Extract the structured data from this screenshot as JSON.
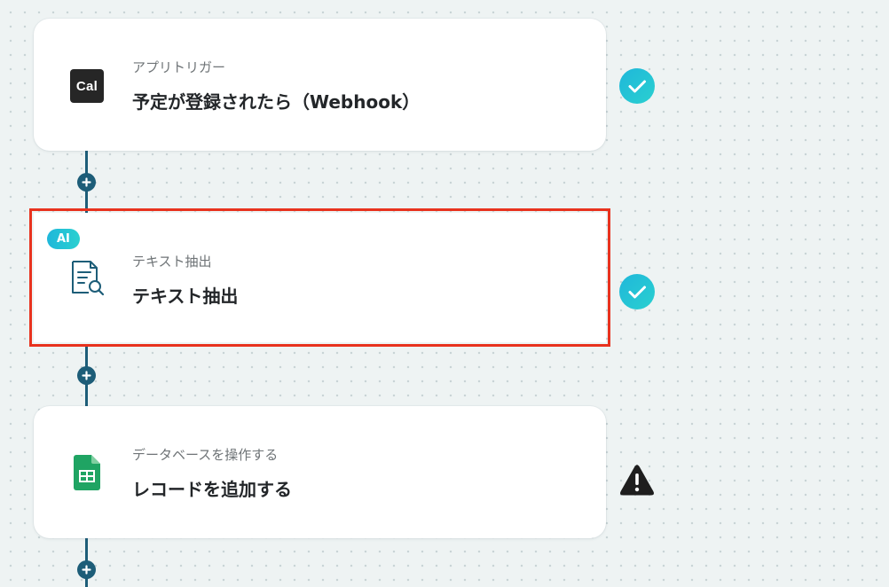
{
  "flow": {
    "steps": [
      {
        "subtitle": "アプリトリガー",
        "title": "予定が登録されたら（Webhook）",
        "icon": "cal-logo",
        "icon_text": "Cal",
        "status": "completed-check-icon"
      },
      {
        "badge": "AI",
        "subtitle": "テキスト抽出",
        "title": "テキスト抽出",
        "icon": "document-search-icon",
        "status": "completed-check-icon",
        "selected": true
      },
      {
        "subtitle": "データベースを操作する",
        "title": "レコードを追加する",
        "icon": "google-sheets-icon",
        "status": "warning-icon"
      }
    ],
    "add_step_icon": "plus-icon"
  },
  "colors": {
    "background": "#eef3f3",
    "connector": "#1d5d78",
    "check_gradient_start": "#1fb7da",
    "check_gradient_end": "#2ad0d0",
    "selection_outline": "#e8321e",
    "sheets_green": "#1fa463",
    "warning": "#1e1e1e"
  }
}
